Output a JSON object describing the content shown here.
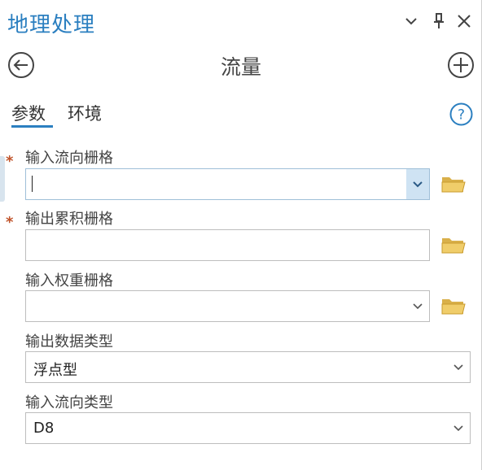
{
  "pane": {
    "title": "地理处理"
  },
  "tool": {
    "title": "流量"
  },
  "tabs": {
    "parameters": "参数",
    "environments": "环境"
  },
  "params": [
    {
      "label": "输入流向栅格",
      "required": true,
      "value": "",
      "has_dropdown": true,
      "has_browse": true
    },
    {
      "label": "输出累积栅格",
      "required": true,
      "value": "",
      "has_dropdown": false,
      "has_browse": true
    },
    {
      "label": "输入权重栅格",
      "required": false,
      "value": "",
      "has_dropdown": true,
      "has_browse": true
    },
    {
      "label": "输出数据类型",
      "required": false,
      "value": "浮点型",
      "has_dropdown": true,
      "has_browse": false
    },
    {
      "label": "输入流向类型",
      "required": false,
      "value": "D8",
      "has_dropdown": true,
      "has_browse": false
    }
  ],
  "required_marker": "*",
  "icons": {
    "back": "back-arrow-circle-icon",
    "add": "add-circle-icon",
    "help": "help-circle-icon",
    "browse": "folder-icon",
    "dropdown": "chevron-down-icon",
    "menu": "chevron-down-icon",
    "pin": "pin-icon",
    "close": "close-icon"
  },
  "colors": {
    "accent": "#2b7fc0",
    "required": "#c0532a",
    "folder": "#e0b84a",
    "active_dropdown_bg": "#cfe3f3"
  }
}
